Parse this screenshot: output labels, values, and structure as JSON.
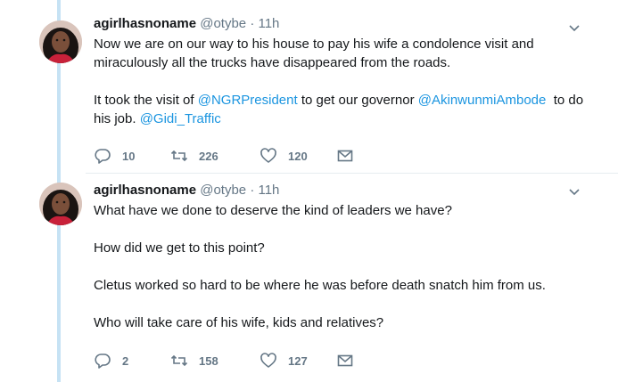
{
  "tweets": [
    {
      "name": "agirlhasnoname",
      "handle": "@otybe",
      "separator": "·",
      "time": "11h",
      "paragraphs": [
        [
          "Now we are on our way to his house to pay his wife a condolence visit and miraculously all the trucks have disappeared from the roads."
        ],
        [
          "It took the visit of ",
          "@NGRPresident",
          " to get our governor ",
          "@AkinwunmiAmbode",
          "  to do his job. ",
          "@Gidi_Traffic"
        ]
      ],
      "replies": "10",
      "retweets": "226",
      "likes": "120"
    },
    {
      "name": "agirlhasnoname",
      "handle": "@otybe",
      "separator": "·",
      "time": "11h",
      "paragraphs": [
        [
          "What have we done to deserve the kind of leaders we have?"
        ],
        [
          "How did we get to this point?"
        ],
        [
          "Cletus worked so hard to be where he was before death snatch him from us."
        ],
        [
          "Who will take care of his wife, kids and relatives?"
        ]
      ],
      "replies": "2",
      "retweets": "158",
      "likes": "127"
    }
  ],
  "colors": {
    "link": "#1b95e0",
    "meta": "#657786",
    "thread": "#c6e2f4"
  },
  "icons": [
    "reply-icon",
    "retweet-icon",
    "like-icon",
    "message-icon",
    "chevron-down-icon"
  ]
}
